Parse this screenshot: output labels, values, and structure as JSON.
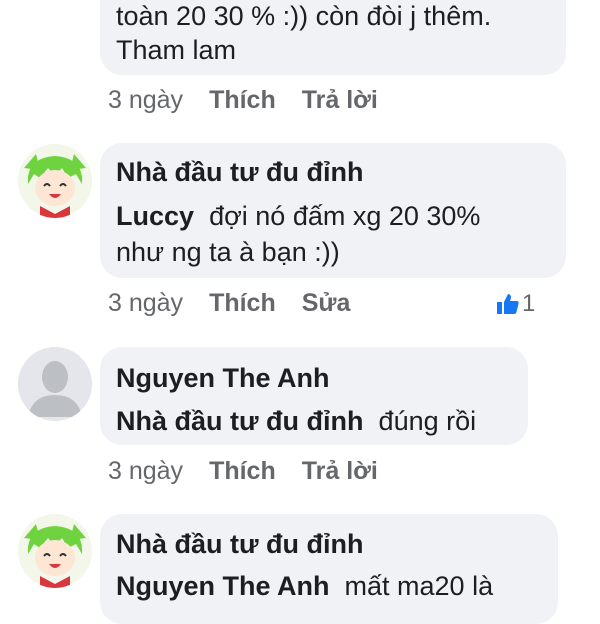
{
  "comments": [
    {
      "text_lines": [
        "toàn 20 30 % :)) còn đòi j thêm.",
        "Tham lam"
      ],
      "time": "3 ngày",
      "actions": [
        "Thích",
        "Trả lời"
      ]
    },
    {
      "author": "Nhà đầu tư đu đỉnh",
      "mention": "Luccy",
      "text_line1": "đợi nó đấm xg 20 30%",
      "text_line2": "như ng ta à bạn :))",
      "time": "3 ngày",
      "actions": [
        "Thích",
        "Sửa"
      ],
      "like_count": "1",
      "avatar_icon": "anime-girl-green-hair-avatar"
    },
    {
      "author": "Nguyen The Anh",
      "mention": "Nhà đầu tư đu đỉnh",
      "text": "đúng rồi",
      "time": "3 ngày",
      "actions": [
        "Thích",
        "Trả lời"
      ],
      "avatar_icon": "default-user-avatar"
    },
    {
      "author": "Nhà đầu tư đu đỉnh",
      "mention": "Nguyen The Anh",
      "text": "mất ma20 là",
      "avatar_icon": "anime-girl-green-hair-avatar"
    }
  ],
  "colors": {
    "bubble": "#f0f2f5",
    "meta": "#65676b",
    "like_blue": "#1877f2"
  }
}
